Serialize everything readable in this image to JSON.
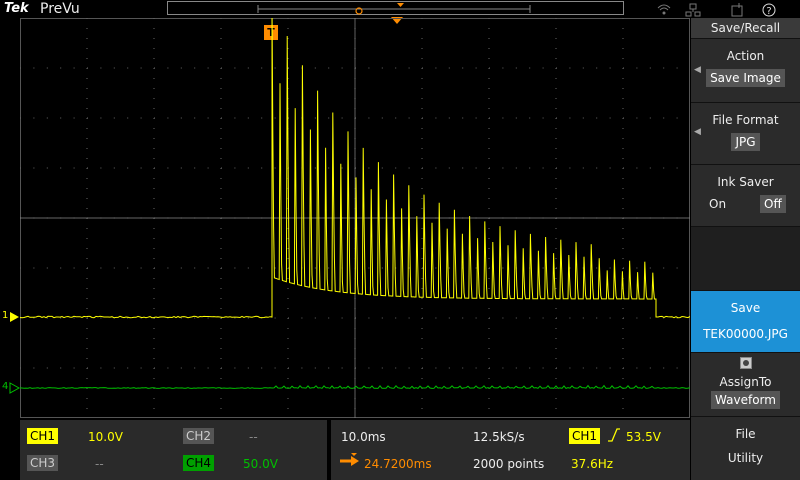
{
  "header": {
    "brand": "Tek",
    "mode": "PreVu"
  },
  "trigger_marker": "T",
  "menu": {
    "title": "Save/Recall",
    "action_label": "Action",
    "action_value": "Save Image",
    "format_label": "File Format",
    "format_value": "JPG",
    "ink_label": "Ink Saver",
    "ink_on": "On",
    "ink_off": "Off",
    "save_label": "Save",
    "save_file": "TEK00000.JPG",
    "assign_label": "AssignTo",
    "assign_value": "Waveform",
    "file_utility_1": "File",
    "file_utility_2": "Utility"
  },
  "channels": {
    "ch1": {
      "label": "CH1",
      "scale": "10.0V",
      "color": "#ffff00"
    },
    "ch2": {
      "label": "CH2",
      "scale": "--"
    },
    "ch3": {
      "label": "CH3",
      "scale": "--"
    },
    "ch4": {
      "label": "CH4",
      "scale": "50.0V",
      "color": "#00c000"
    }
  },
  "timebase": {
    "scale": "10.0ms",
    "delay": "24.7200ms",
    "rate": "12.5kS/s",
    "points": "2000 points"
  },
  "trigger": {
    "source": "CH1",
    "level": "53.5V",
    "freq": "37.6Hz"
  },
  "markers": {
    "ch1": "1",
    "ch4": "4"
  }
}
